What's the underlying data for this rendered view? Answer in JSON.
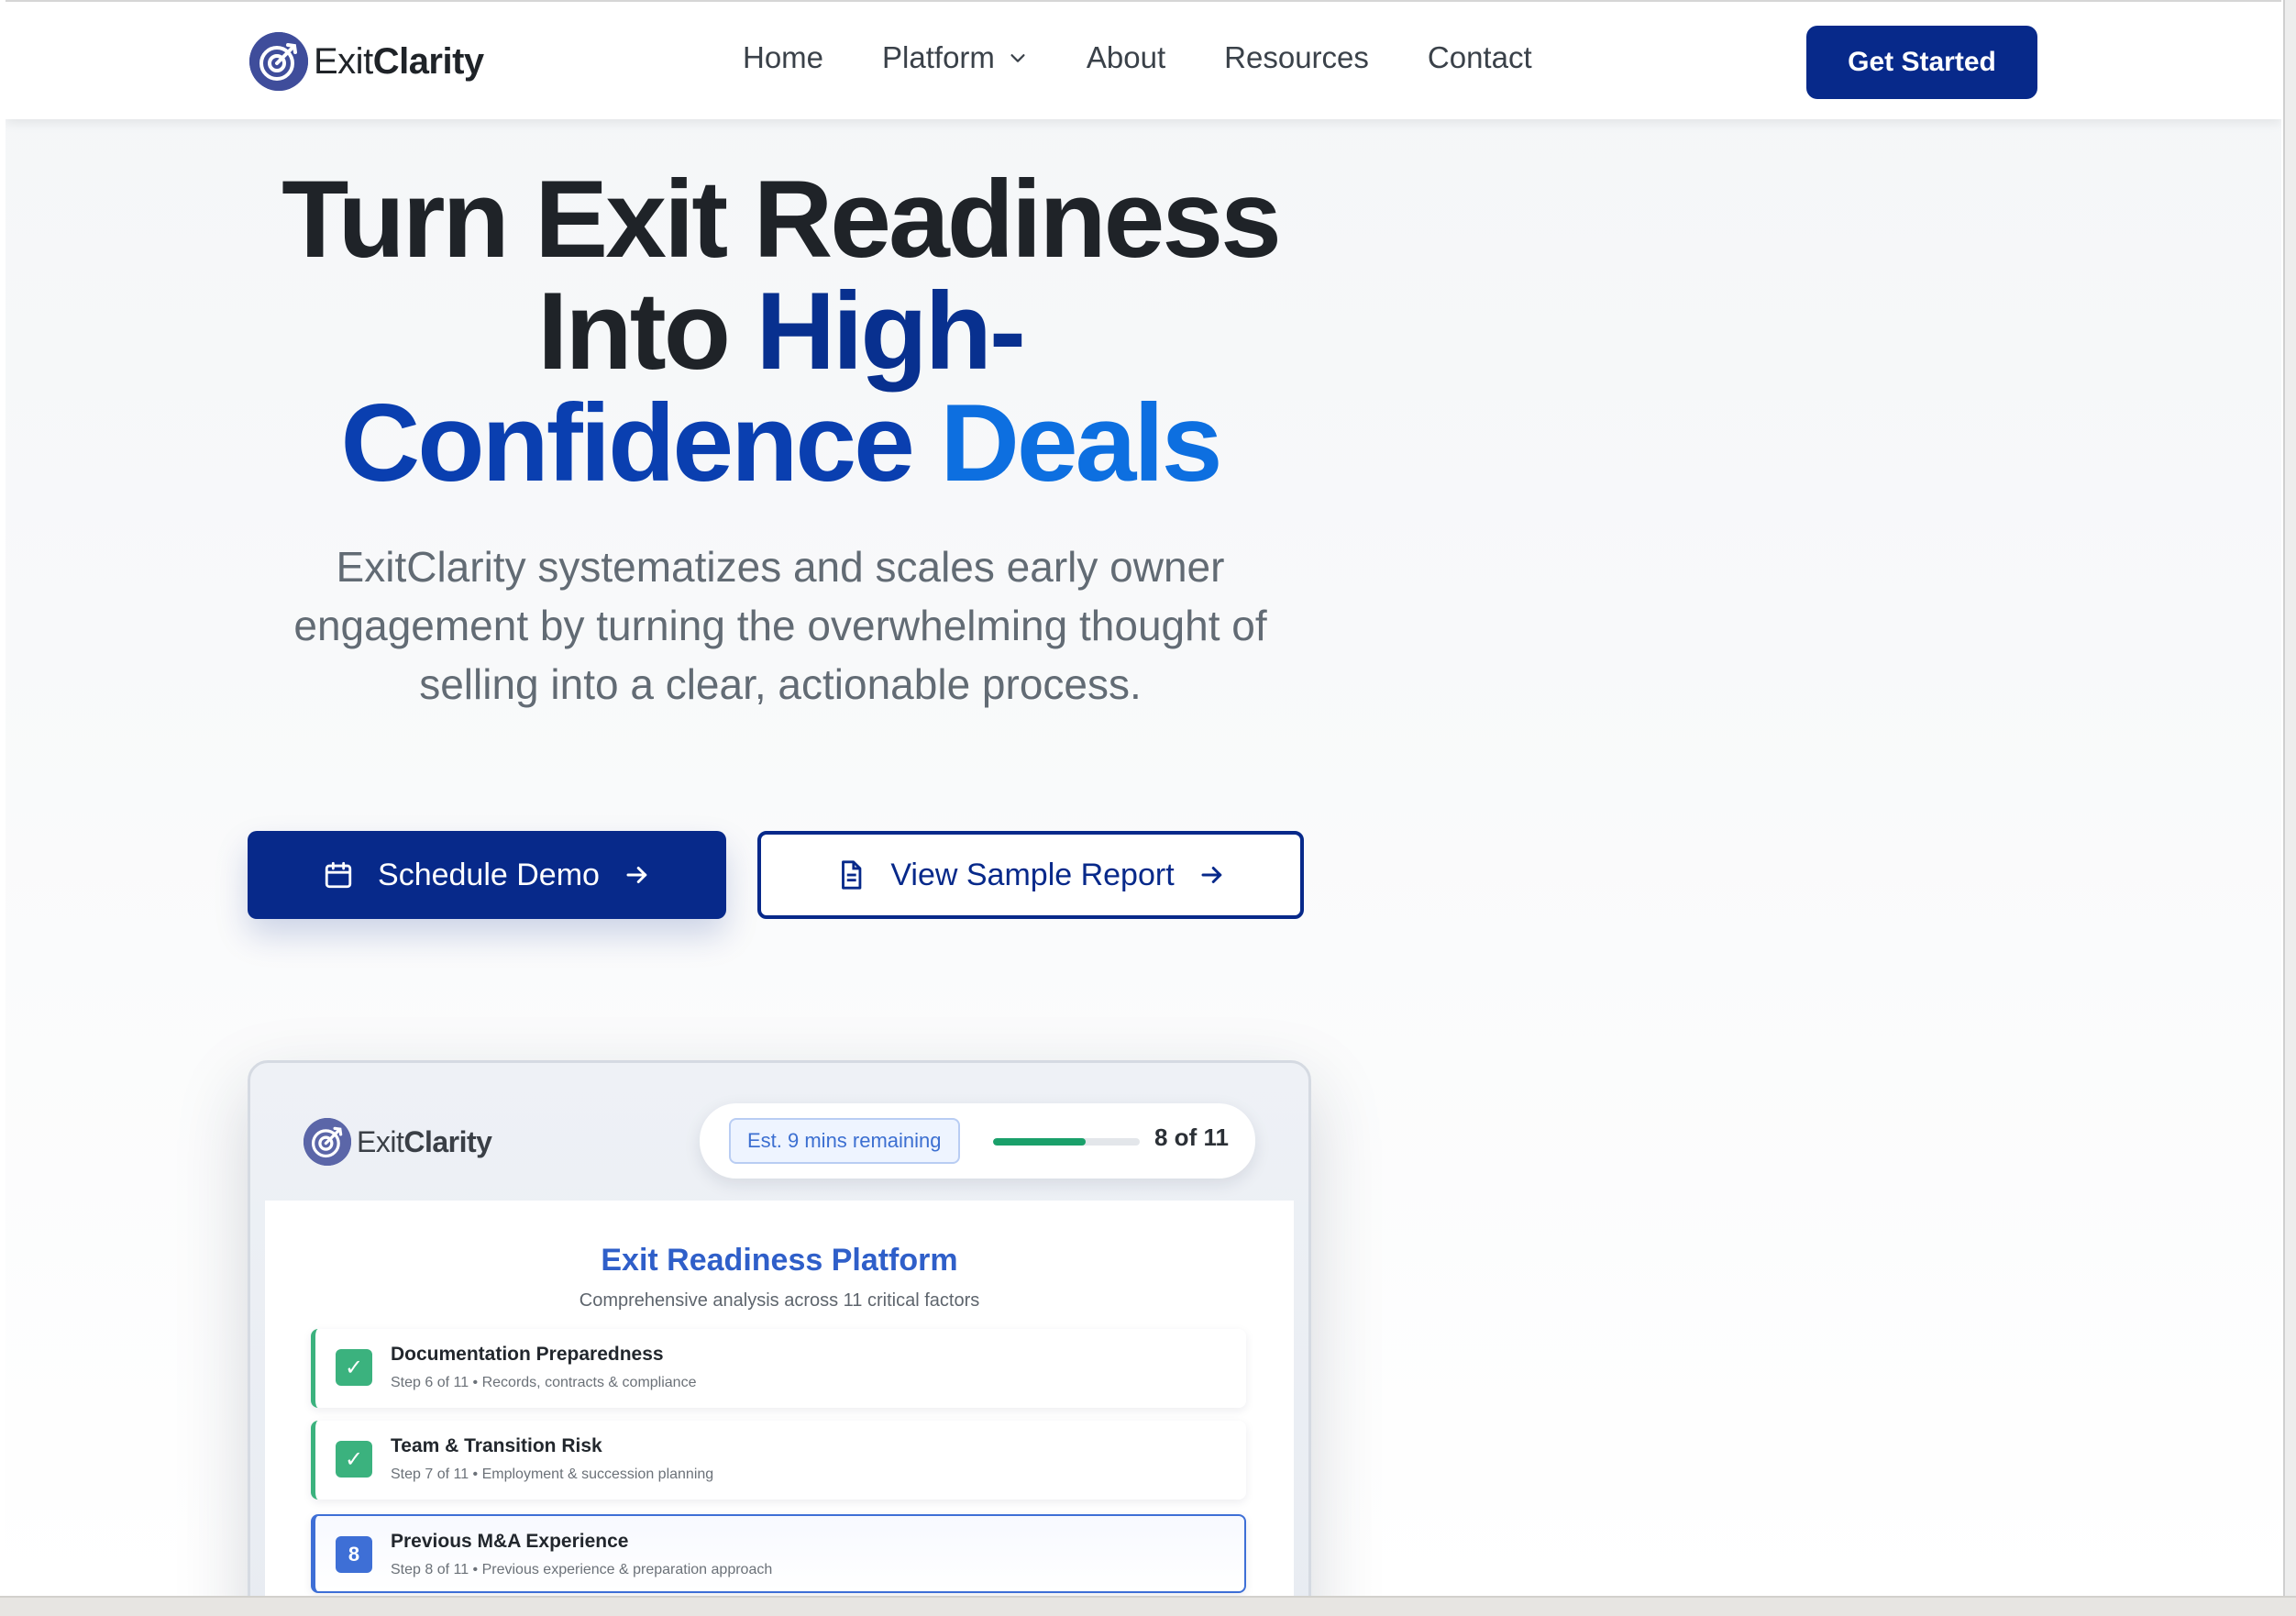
{
  "brand": {
    "name_light": "Exit",
    "name_bold": "Clarity"
  },
  "nav": {
    "links": [
      "Home",
      "Platform",
      "About",
      "Resources",
      "Contact"
    ],
    "cta": "Get Started"
  },
  "hero": {
    "title_line1": "Turn Exit Readiness",
    "title_line2a": "Into ",
    "title_line2b": "High-",
    "title_line3a": "Confidence ",
    "title_line3b": "Deals",
    "subtitle": "ExitClarity systematizes and scales early owner engagement by turning the overwhelming thought of selling into a clear, actionable process.",
    "primary_cta": "Schedule Demo",
    "secondary_cta": "View Sample Report"
  },
  "mockup": {
    "eta": "Est. 9 mins remaining",
    "progress_fraction": 0.63,
    "progress_label": "8 of 11",
    "title": "Exit Readiness Platform",
    "subtitle": "Comprehensive analysis across 11 critical factors",
    "steps": [
      {
        "title": "Documentation Preparedness",
        "meta": "Step 6 of 11 • Records, contracts & compliance",
        "status": "complete"
      },
      {
        "title": "Team & Transition Risk",
        "meta": "Step 7 of 11 • Employment & succession planning",
        "status": "complete"
      },
      {
        "number": "8",
        "title": "Previous M&A Experience",
        "meta": "Step 8 of 11 • Previous experience & preparation approach",
        "status": "current"
      }
    ]
  },
  "colors": {
    "primary": "#07298a",
    "accent_light": "#0d6fe0",
    "success": "#1aa06a"
  },
  "icons": {
    "logo": "target-arrow-icon",
    "platform_dropdown": "chevron-down-icon",
    "demo": "calendar-icon",
    "report": "document-icon",
    "arrow": "arrow-right-icon",
    "check": "check-icon"
  }
}
